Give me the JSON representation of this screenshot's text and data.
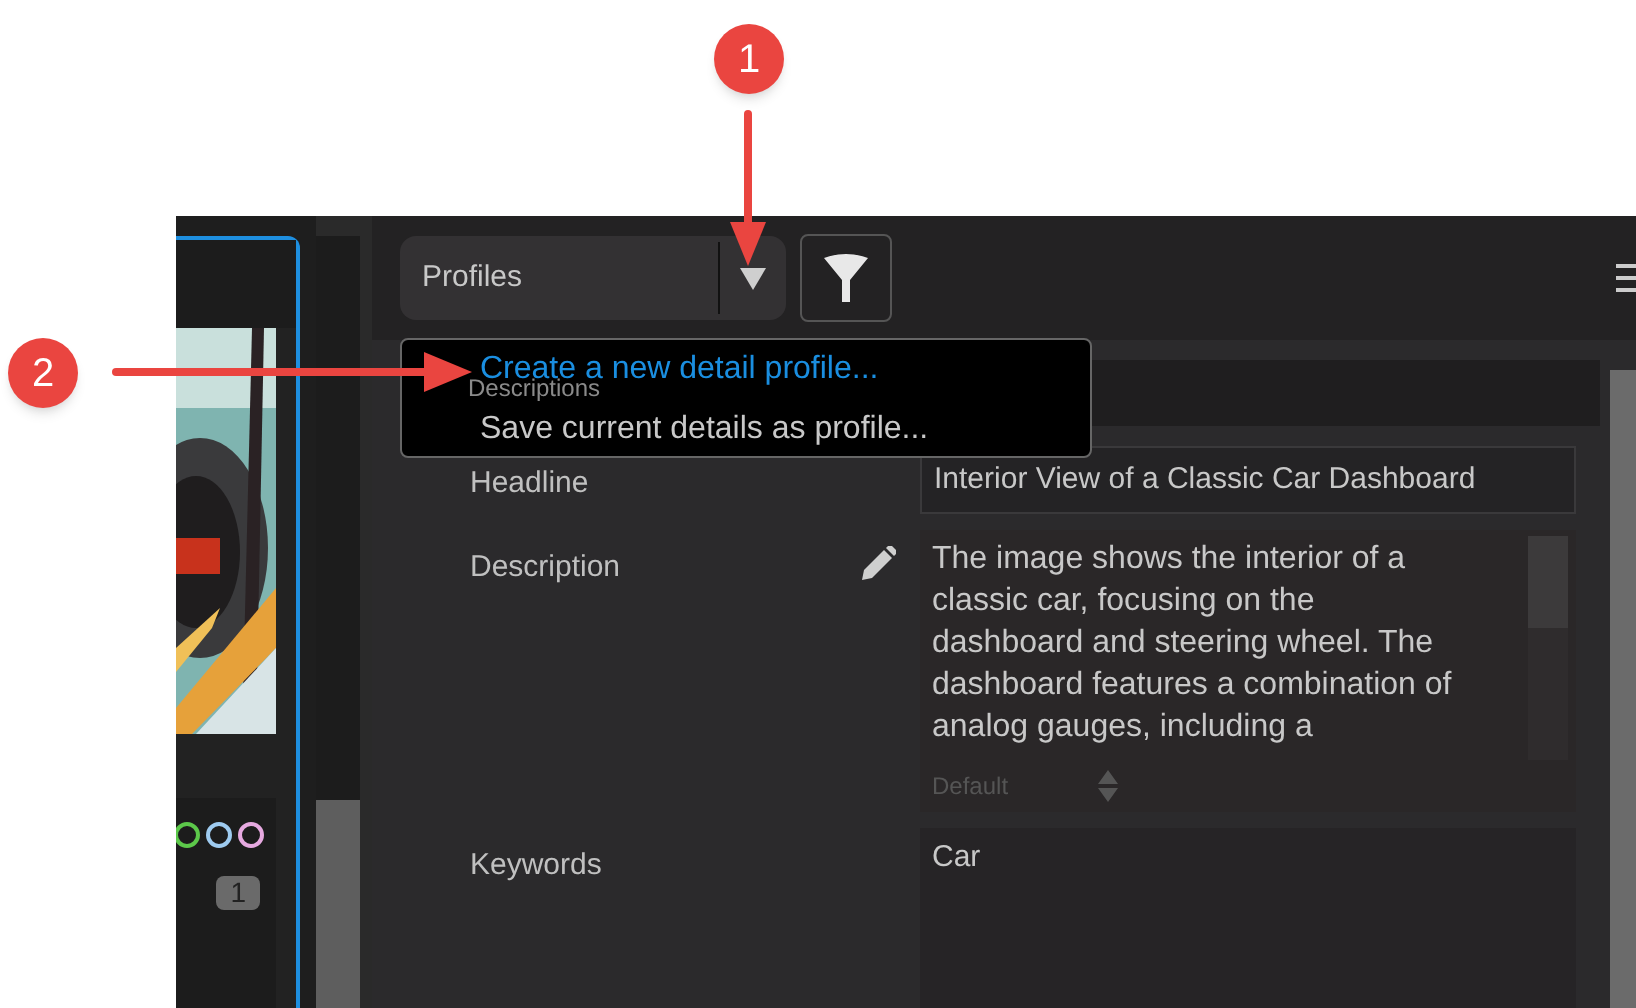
{
  "annotations": [
    {
      "number": "1"
    },
    {
      "number": "2"
    }
  ],
  "thumbnail": {
    "color_labels": [
      {
        "color": "#5cc84a"
      },
      {
        "color": "#9ecbf0"
      },
      {
        "color": "#e6a9e0"
      }
    ],
    "badge": "1"
  },
  "toolbar": {
    "profiles": {
      "label": "Profiles",
      "expanded": true
    }
  },
  "profiles_menu": [
    {
      "label": "Create a new detail profile...",
      "selected": true
    },
    {
      "label": "Save current details as profile...",
      "selected": false
    }
  ],
  "section": {
    "title": "Descriptions"
  },
  "fields": [
    {
      "kind": "line",
      "label": "Headline",
      "value": "Interior View of a Classic Car Dashboard"
    },
    {
      "kind": "text",
      "label": "Description",
      "value": "The image shows the interior of a classic car, focusing on the dashboard and steering wheel. The dashboard features a combination of analog gauges, including a",
      "footer": "Default"
    },
    {
      "kind": "area",
      "label": "Keywords",
      "value": "Car"
    }
  ]
}
